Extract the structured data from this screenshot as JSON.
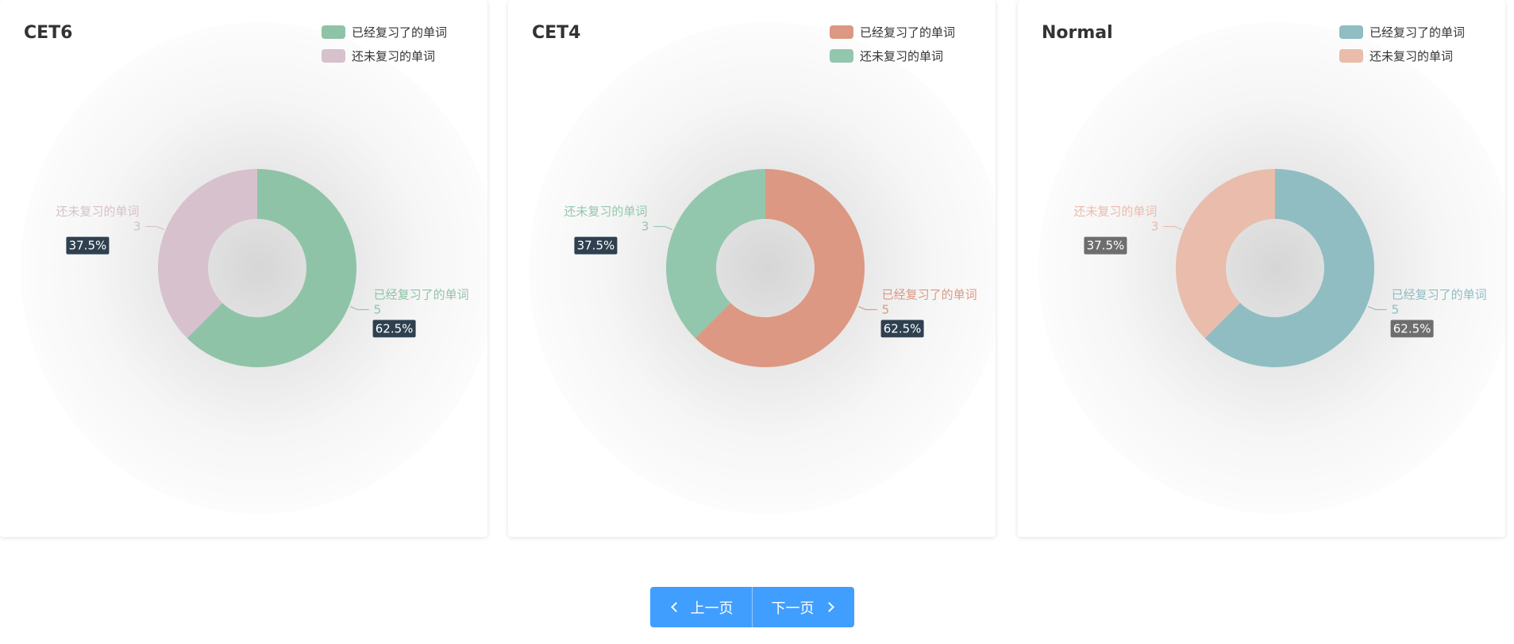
{
  "charts": [
    {
      "title": "CET6",
      "colors": {
        "reviewed": "#8fc3a7",
        "not_reviewed": "#d6c1cc",
        "pct_box": "#2f4050"
      },
      "pct_box_style": "dark"
    },
    {
      "title": "CET4",
      "colors": {
        "reviewed": "#dc9882",
        "not_reviewed": "#93c7ad",
        "pct_box": "#2f4050"
      },
      "pct_box_style": "dark"
    },
    {
      "title": "Normal",
      "colors": {
        "reviewed": "#8fbdc2",
        "not_reviewed": "#e9bcab",
        "pct_box": "#6e6e6e"
      },
      "pct_box_style": "gray"
    }
  ],
  "chart_data": [
    {
      "type": "pie",
      "title": "CET6",
      "categories": [
        "已经复习了的单词",
        "还未复习的单词"
      ],
      "values": [
        5,
        3
      ],
      "percentages": [
        "62.5%",
        "37.5%"
      ],
      "legend_position": "top-right",
      "donut": true
    },
    {
      "type": "pie",
      "title": "CET4",
      "categories": [
        "已经复习了的单词",
        "还未复习的单词"
      ],
      "values": [
        5,
        3
      ],
      "percentages": [
        "62.5%",
        "37.5%"
      ],
      "legend_position": "top-right",
      "donut": true
    },
    {
      "type": "pie",
      "title": "Normal",
      "categories": [
        "已经复习了的单词",
        "还未复习的单词"
      ],
      "values": [
        5,
        3
      ],
      "percentages": [
        "62.5%",
        "37.5%"
      ],
      "legend_position": "top-right",
      "donut": true
    }
  ],
  "pager": {
    "prev_label": "上一页",
    "next_label": "下一页",
    "color": "#409eff"
  }
}
